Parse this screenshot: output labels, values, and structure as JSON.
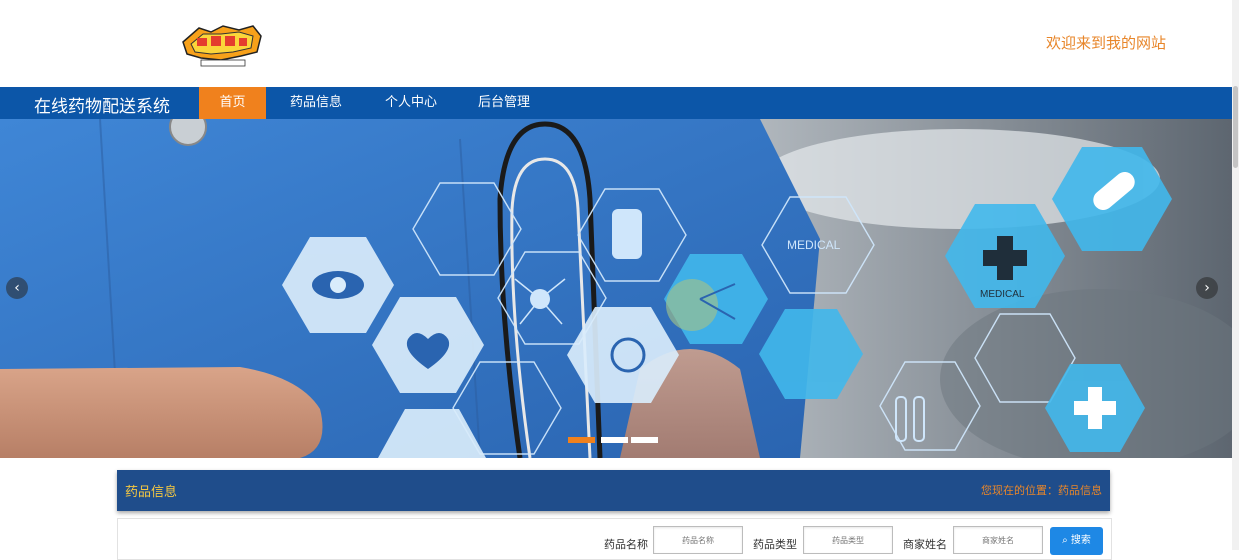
{
  "header": {
    "logo_alt": "Digimon Adventure logo",
    "welcome_text": "欢迎来到我的网站"
  },
  "nav": {
    "brand": "在线药物配送系统",
    "items": [
      {
        "label": "首页",
        "active": true
      },
      {
        "label": "药品信息",
        "active": false
      },
      {
        "label": "个人中心",
        "active": false
      },
      {
        "label": "后台管理",
        "active": false
      }
    ]
  },
  "banner": {
    "hex_labels": [
      "MEDICAL",
      "MEDICAL"
    ],
    "slide_count": 3,
    "active_slide": 1,
    "prev_icon": "‹",
    "next_icon": "›"
  },
  "section": {
    "title": "药品信息",
    "breadcrumb": "您现在的位置：药品信息"
  },
  "search": {
    "name_label": "药品名称",
    "name_placeholder": "药品名称",
    "type_label": "药品类型",
    "type_placeholder": "药品类型",
    "merchant_label": "商家姓名",
    "merchant_placeholder": "商家姓名",
    "button_label": "搜索"
  },
  "colors": {
    "nav_bg": "#0c56a8",
    "nav_active": "#f0811d",
    "welcome": "#e8862a",
    "section_bg": "#1f4d8b",
    "section_title": "#f5c842",
    "search_button": "#1e88e5"
  }
}
